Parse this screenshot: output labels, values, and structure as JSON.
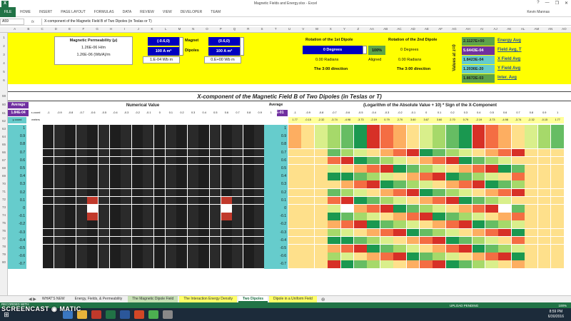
{
  "window": {
    "title": "Magnetic Fields and Energy.xlsx - Excel",
    "buttons": [
      "?",
      "—",
      "❐",
      "✕"
    ]
  },
  "ribbon": {
    "file": "FILE",
    "tabs": [
      "HOME",
      "INSERT",
      "PAGE LAYOUT",
      "FORMULAS",
      "DATA",
      "REVIEW",
      "VIEW",
      "DEVELOPER",
      "TEAM"
    ],
    "user": "Kevin Mannas"
  },
  "formula_bar": {
    "name_box": "A59",
    "fx": "fx",
    "content": "X-component of the Magnetic Field B of Two Dipoles (in Teslas or T)"
  },
  "columns": [
    "A",
    "B",
    "C",
    "D",
    "E",
    "F",
    "G",
    "H",
    "I",
    "J",
    "K",
    "L",
    "M",
    "N",
    "O",
    "P",
    "Q",
    "R",
    "S",
    "T",
    "U",
    "V",
    "W",
    "X",
    "Y",
    "Z",
    "AA",
    "AB",
    "AC",
    "AD",
    "AE",
    "AF",
    "AG",
    "AH",
    "AI",
    "AJ",
    "AK",
    "AL",
    "AM",
    "AN",
    "AO"
  ],
  "rows": [
    "1",
    "2",
    "3",
    "4",
    "5",
    "6",
    "59",
    "60",
    "61",
    "62",
    "63",
    "64",
    "65",
    "66",
    "67",
    "68",
    "69",
    "70",
    "71",
    "72",
    "73",
    "74",
    "75",
    "76",
    "77",
    "78",
    "79",
    "80"
  ],
  "params": {
    "perm_label": "Magnetic Permeability (μ)",
    "perm_value1": "1.26E-06 H/m",
    "perm_value2": "1.26E-06 (Wb/A)/m",
    "magnet_label": "Magnet",
    "dipoles_label": "Dipoles",
    "dipole1_pos": "(-0.6,0)",
    "dipole1_moment": "100 A m²",
    "dipole1_flux": "1.E-04 Wb m",
    "dipole2_pos": "(0.6,0)",
    "dipole2_moment": "100 A m²",
    "dipole2_flux": "0.E+00 Wb m",
    "rot1_label": "Rotation of the 1st Dipole",
    "rot1_deg": "0 Degrees",
    "rot1_rad": "0.00 Radians",
    "rot1_dir": "The 3:00 direction",
    "percent": "100%",
    "aligned": "Aligned",
    "rot2_label": "Rotation of the 2nd Dipole",
    "rot2_deg": "0 Degrees",
    "rot2_rad": "0.00 Radians",
    "rot2_dir": "The 3:00 direction",
    "vertical_label": "Values at z=0",
    "energy_val": "2.1127E+00",
    "energy_lbl": "Energy Avg",
    "field_val": "5.6443E-04",
    "field_lbl": "Field Avg, T",
    "x_val": "1.8423E-04",
    "x_lbl": "X Field Avg",
    "y_val": "1.2036E-20",
    "y_lbl": "Y Field Avg",
    "inter_val": "1.8672E-03",
    "inter_lbl": "Inter. Avg"
  },
  "section": {
    "title": "X-component of the Magnetic Field B of Two Dipoles (in Teslas or T)",
    "left_header": "Numerical Value",
    "right_header": "(Logarithm of the Absolute Value + 10) * Sign of the X-Component",
    "average_label": "Average",
    "left_average": "1.84E-04",
    "right_average": "-6.83E-01",
    "xcoord": "x-coord",
    "ycoord": "y-coord",
    "meters": "meters",
    "x_values": [
      "-1",
      "-0.9",
      "-0.8",
      "-0.7",
      "-0.6",
      "-0.5",
      "-0.4",
      "-0.3",
      "-0.2",
      "-0.1",
      "0",
      "0.1",
      "0.2",
      "0.3",
      "0.4",
      "0.5",
      "0.6",
      "0.7",
      "0.8",
      "0.9",
      "1"
    ],
    "y_values": [
      "1",
      "0.9",
      "0.8",
      "0.7",
      "0.6",
      "0.5",
      "0.4",
      "0.3",
      "0.2",
      "0.1",
      "0",
      "-0.1",
      "-0.2",
      "-0.3",
      "-0.4",
      "-0.5",
      "-0.6",
      "-0.7"
    ],
    "right_top_values": [
      "1.77",
      "-0.15",
      "-2.32",
      "-3.74",
      "-4.98",
      "-3.73",
      "-2.19",
      "0.79",
      "2.70",
      "3.60",
      "3.67",
      "3.60",
      "2.70",
      "0.79",
      "-2.19",
      "-3.73",
      "-4.98",
      "-3.74",
      "-2.32",
      "-0.15",
      "1.77"
    ]
  },
  "sheet_tabs": [
    "WHAT'S NEW",
    "Energy, Fields, & Permeability",
    "The Magnetic Dipole Field",
    "The Interaction Energy Density",
    "Two Dipoles",
    "Dipole in a Uniform Field"
  ],
  "active_tab": "Two Dipoles",
  "status": {
    "left": "RECORDED WITH",
    "upload": "UPLOAD PENDING",
    "zoom": "100%"
  },
  "watermark": "SCREENCAST ◉ MATIC",
  "clock": {
    "time": "8:59 PM",
    "date": "6/30/2016"
  },
  "colors": {
    "excel_green": "#217346",
    "yellow": "#ffff00",
    "blue": "#0000c0",
    "teal": "#66cccc",
    "purple": "#7030a0"
  }
}
